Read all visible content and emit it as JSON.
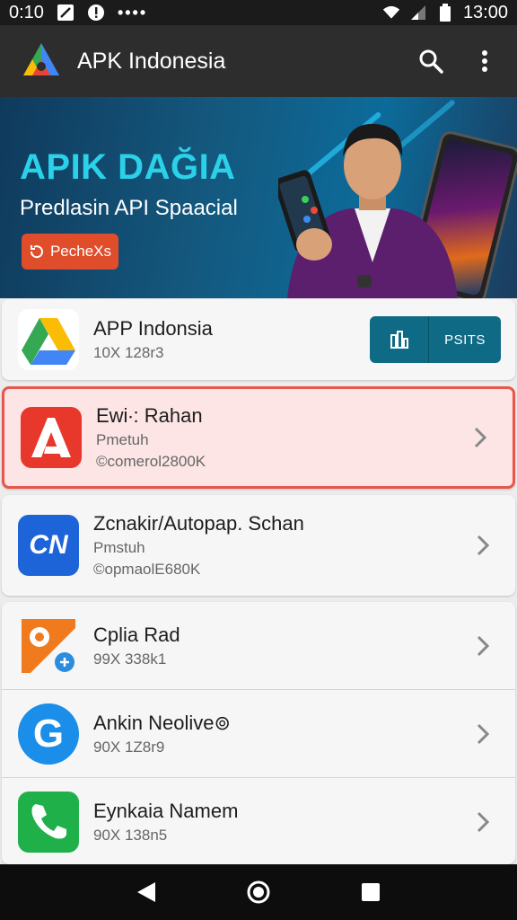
{
  "status": {
    "time_left": "0:10",
    "time_right": "13:00",
    "dots": "••••"
  },
  "appbar": {
    "title": "APK Indonesia",
    "logo_icon": "apk-logo-icon",
    "search_icon": "search-icon",
    "more_icon": "more-vert-icon"
  },
  "banner": {
    "headline": "APIK DAĞIA",
    "subtitle": "Predlasin API Spaacial",
    "cta_label": "PecheXs",
    "accent": "#2ad1e8",
    "cta_color": "#e04d2b"
  },
  "featured": {
    "name": "APP Indonsia",
    "meta": "10X 128r3",
    "button_label": "PSITS",
    "icon": "google-drive-style-icon"
  },
  "apps": [
    {
      "name": "Ewi∙: Rahan",
      "dev": "Pmetuh",
      "meta": "©comerol2800K",
      "icon": "adobe-style-icon",
      "highlighted": true
    },
    {
      "name": "Zcnakir/Autopap. Schan",
      "dev": "Pmstuh",
      "meta": "©opmaolE680K",
      "icon": "cn-logo-icon",
      "icon_text": "CN"
    }
  ],
  "list": [
    {
      "name": "Cplia Rad",
      "meta": "99X 338k1",
      "icon": "settings-app-icon"
    },
    {
      "name": "Ankin Neolive⊚",
      "meta": "90X 1Z8r9",
      "icon": "google-g-icon",
      "icon_text": "G"
    },
    {
      "name": "Eynkaia Namem",
      "meta": "90X 138n5",
      "icon": "phone-app-icon"
    }
  ],
  "colors": {
    "highlight_border": "#e9574c",
    "highlight_bg": "#fde5e5",
    "button_teal": "#0e6a85"
  }
}
